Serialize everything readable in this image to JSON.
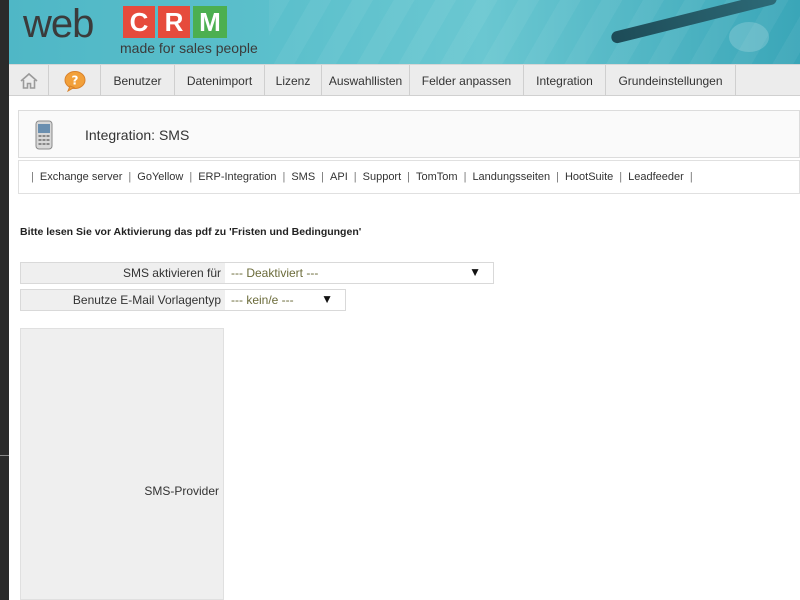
{
  "header": {
    "logo": {
      "web": "web",
      "letters": [
        "C",
        "R",
        "M"
      ],
      "tagline": "made for sales people"
    }
  },
  "nav": {
    "home_icon": "home-icon",
    "help_icon": "help-bubble-icon",
    "items": [
      {
        "label": "Benutzer",
        "width": 0
      },
      {
        "label": "Datenimport"
      },
      {
        "label": "Lizenz"
      },
      {
        "label": "Auswahllisten"
      },
      {
        "label": "Felder anpassen"
      },
      {
        "label": "Integration"
      },
      {
        "label": "Grundeinstellungen"
      }
    ]
  },
  "page": {
    "icon": "mobile-phone-icon",
    "title": "Integration: SMS"
  },
  "subnav": {
    "items": [
      "Exchange server",
      "GoYellow",
      "ERP-Integration",
      "SMS",
      "API",
      "Support",
      "TomTom",
      "Landungsseiten",
      "HootSuite",
      "Leadfeeder"
    ]
  },
  "notice": "Bitte lesen Sie vor Aktivierung das pdf zu 'Fristen und Bedingungen'",
  "form": {
    "sms_activate": {
      "label": "SMS aktivieren für",
      "value": "--- Deaktiviert ---"
    },
    "email_template": {
      "label": "Benutze E-Mail Vorlagentyp",
      "value": "--- kein/e ---"
    },
    "provider": {
      "label": "SMS-Provider"
    }
  },
  "colors": {
    "header_teal": "#5cc0cc",
    "logo_red": "#e64b3c",
    "logo_green": "#4caf50",
    "nav_bg": "#ececec"
  }
}
